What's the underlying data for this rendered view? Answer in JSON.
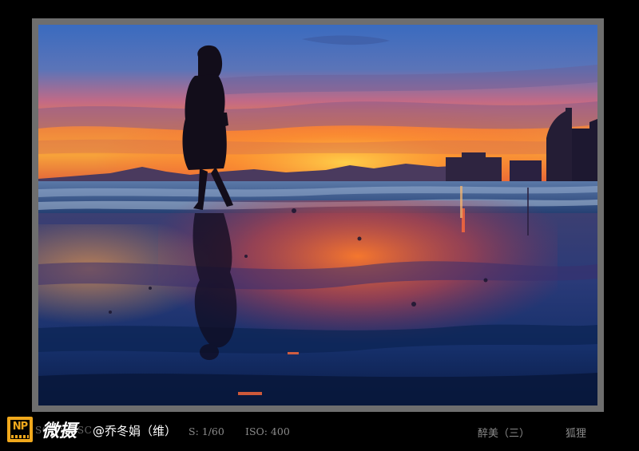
{
  "overlay": {
    "platform": "微摄",
    "author": "@乔冬娟（维）"
  },
  "exif": {
    "ghost_prefix": "SONY  DSC",
    "shutter": "S: 1/60",
    "iso": "ISO: 400"
  },
  "caption": {
    "title": "醉美（三）",
    "photographer": "狐狸"
  },
  "logo": {
    "text": "NP"
  },
  "colors": {
    "background": "#000000",
    "frame": "#6e6e6e",
    "logo_accent": "#f0a81c",
    "caption_text": "#8a8a8a"
  }
}
